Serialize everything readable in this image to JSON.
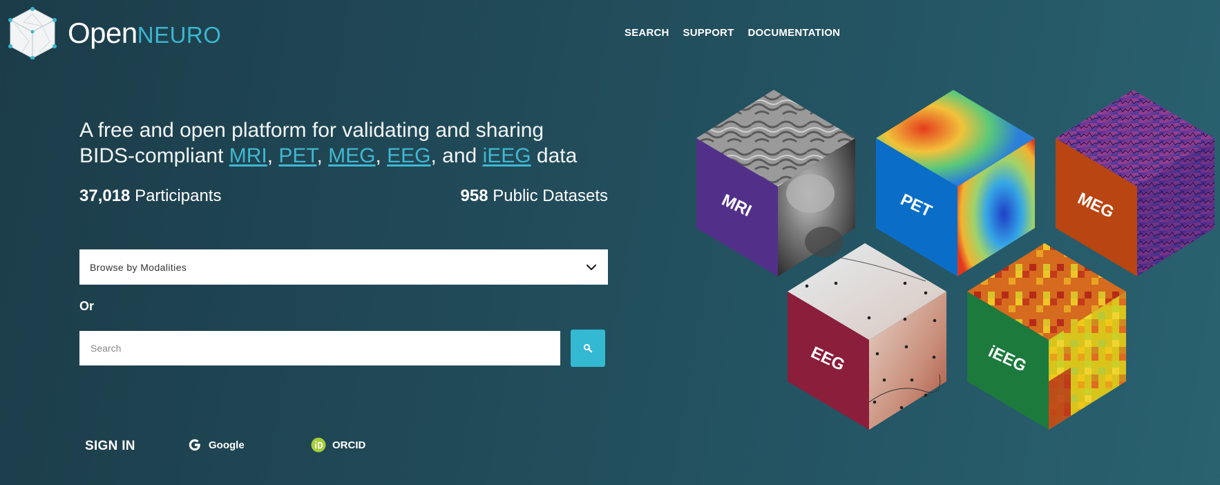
{
  "brand": {
    "name_part1": "Open",
    "name_part2": "NEURO"
  },
  "nav": {
    "items": [
      "SEARCH",
      "SUPPORT",
      "DOCUMENTATION"
    ]
  },
  "hero": {
    "tagline_prefix": "A free and open platform for validating and sharing BIDS-compliant ",
    "modalities": [
      "MRI",
      "PET",
      "MEG",
      "EEG",
      "iEEG"
    ],
    "sep1": ", ",
    "sep_and": ", and ",
    "tagline_suffix": " data"
  },
  "stats": {
    "participants_count": "37,018",
    "participants_label": " Participants",
    "datasets_count": "958",
    "datasets_label": " Public Datasets"
  },
  "browse": {
    "selected": "Browse by Modalities"
  },
  "or_label": "Or",
  "search": {
    "placeholder": "Search"
  },
  "signin": {
    "label": "SIGN IN",
    "google": "Google",
    "orcid": "ORCID"
  },
  "cubes": [
    {
      "label": "MRI",
      "side_color": "#52308a"
    },
    {
      "label": "PET",
      "side_color": "#0a6ec9"
    },
    {
      "label": "MEG",
      "side_color": "#b94512"
    },
    {
      "label": "EEG",
      "side_color": "#8b1e3b"
    },
    {
      "label": "iEEG",
      "side_color": "#1b7a3c"
    }
  ],
  "colors": {
    "accent": "#33b9d2",
    "background": "#214a58"
  }
}
